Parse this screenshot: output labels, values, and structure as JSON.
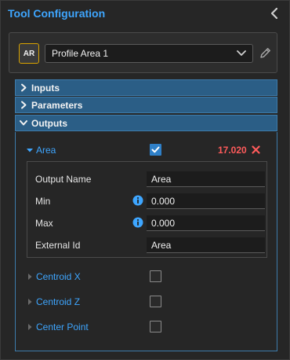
{
  "header": {
    "title": "Tool Configuration",
    "collapse_icon": "chevron-left-icon"
  },
  "tool": {
    "badge": "AR",
    "selected_name": "Profile Area 1",
    "edit_icon": "pencil-icon"
  },
  "sections": {
    "inputs": "Inputs",
    "parameters": "Parameters",
    "outputs": "Outputs"
  },
  "outputs": {
    "area": {
      "label": "Area",
      "checked": true,
      "value": "17.020",
      "fields": {
        "output_name": {
          "label": "Output Name",
          "value": "Area"
        },
        "min": {
          "label": "Min",
          "value": "0.000"
        },
        "max": {
          "label": "Max",
          "value": "0.000"
        },
        "external_id": {
          "label": "External Id",
          "value": "Area"
        }
      }
    },
    "items": [
      {
        "label": "Centroid X",
        "checked": false
      },
      {
        "label": "Centroid Z",
        "checked": false
      },
      {
        "label": "Center Point",
        "checked": false
      }
    ]
  },
  "colors": {
    "accent": "#3ea6ff",
    "section_bg": "#2b5e86",
    "error": "#ff5b5b",
    "badge_border": "#d9a300"
  }
}
